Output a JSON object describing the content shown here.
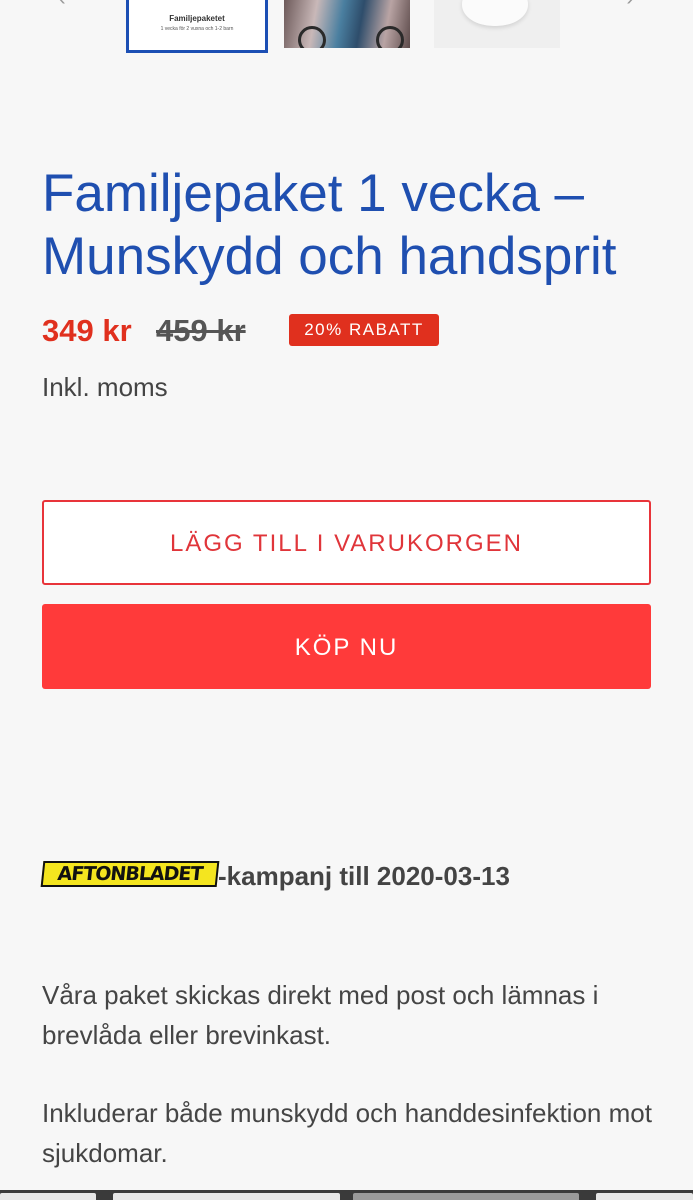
{
  "gallery": {
    "thumb1_title": "Familjepaketet",
    "thumb1_sub": "1 vecka för 2 vuxna och 1-2 barn",
    "prev_icon": "chevron-left-icon",
    "next_icon": "chevron-right-icon"
  },
  "product": {
    "title": "Familjepaket 1 vecka – Munskydd och handsprit",
    "price": "349 kr",
    "old_price": "459 kr",
    "discount_badge": "20% RABATT",
    "tax_note": "Inkl. moms"
  },
  "actions": {
    "add_to_cart": "LÄGG TILL I VARUKORGEN",
    "buy_now": "KÖP NU"
  },
  "campaign": {
    "logo_text": "AFTONBLADET",
    "text": "-kampanj till 2020-03-13"
  },
  "description": {
    "paragraph1": "Våra paket skickas direkt med post och lämnas i brevlåda eller brevinkast.",
    "paragraph2": "Inkluderar både munskydd och handdesinfektion mot sjukdomar."
  },
  "colors": {
    "title": "#1f4fb0",
    "price": "#e0301e",
    "buy_button": "#ff3a3a",
    "logo": "#f4e51f"
  }
}
